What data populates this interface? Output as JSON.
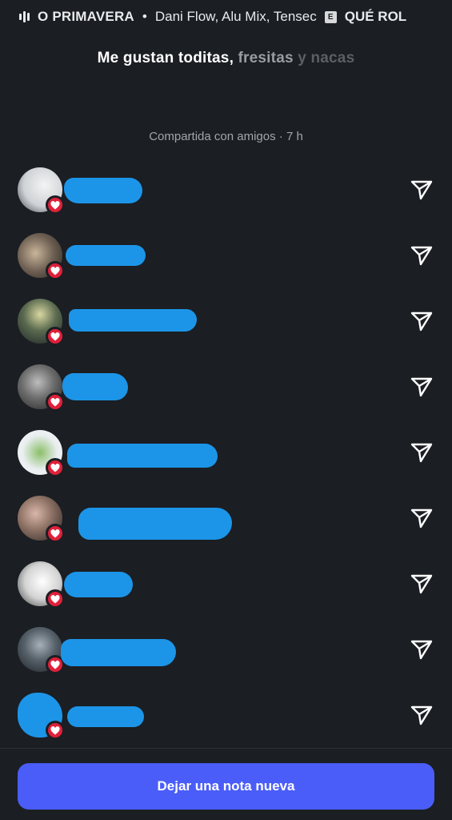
{
  "now_playing": {
    "title": "O PRIMAVERA",
    "separator": "•",
    "artists": "Dani Flow, Alu Mix, Tensec",
    "explicit_badge": "E",
    "next_title": "QUÉ ROL"
  },
  "note": {
    "part1": "Me gustan toditas,",
    "part2": "fresitas",
    "part3": "y nacas"
  },
  "shared_label": "Compartida con amigos · 7 h",
  "likers": [
    {
      "name": "",
      "reacted": true
    },
    {
      "name": "",
      "reacted": true
    },
    {
      "name": "",
      "reacted": true
    },
    {
      "name": "",
      "reacted": true
    },
    {
      "name": "",
      "reacted": true
    },
    {
      "name": "",
      "reacted": true
    },
    {
      "name": "",
      "reacted": true
    },
    {
      "name": "",
      "reacted": true
    },
    {
      "name": "",
      "reacted": true
    }
  ],
  "footer": {
    "new_note_label": "Dejar una nota nueva"
  },
  "colors": {
    "background": "#1b1e23",
    "heart": "#e0203a",
    "primary_button": "#4a5df9",
    "redaction": "#1c95e8"
  },
  "icons": {
    "row_action": "send-icon",
    "badge": "heart-icon",
    "now_playing": "equalizer-icon"
  }
}
